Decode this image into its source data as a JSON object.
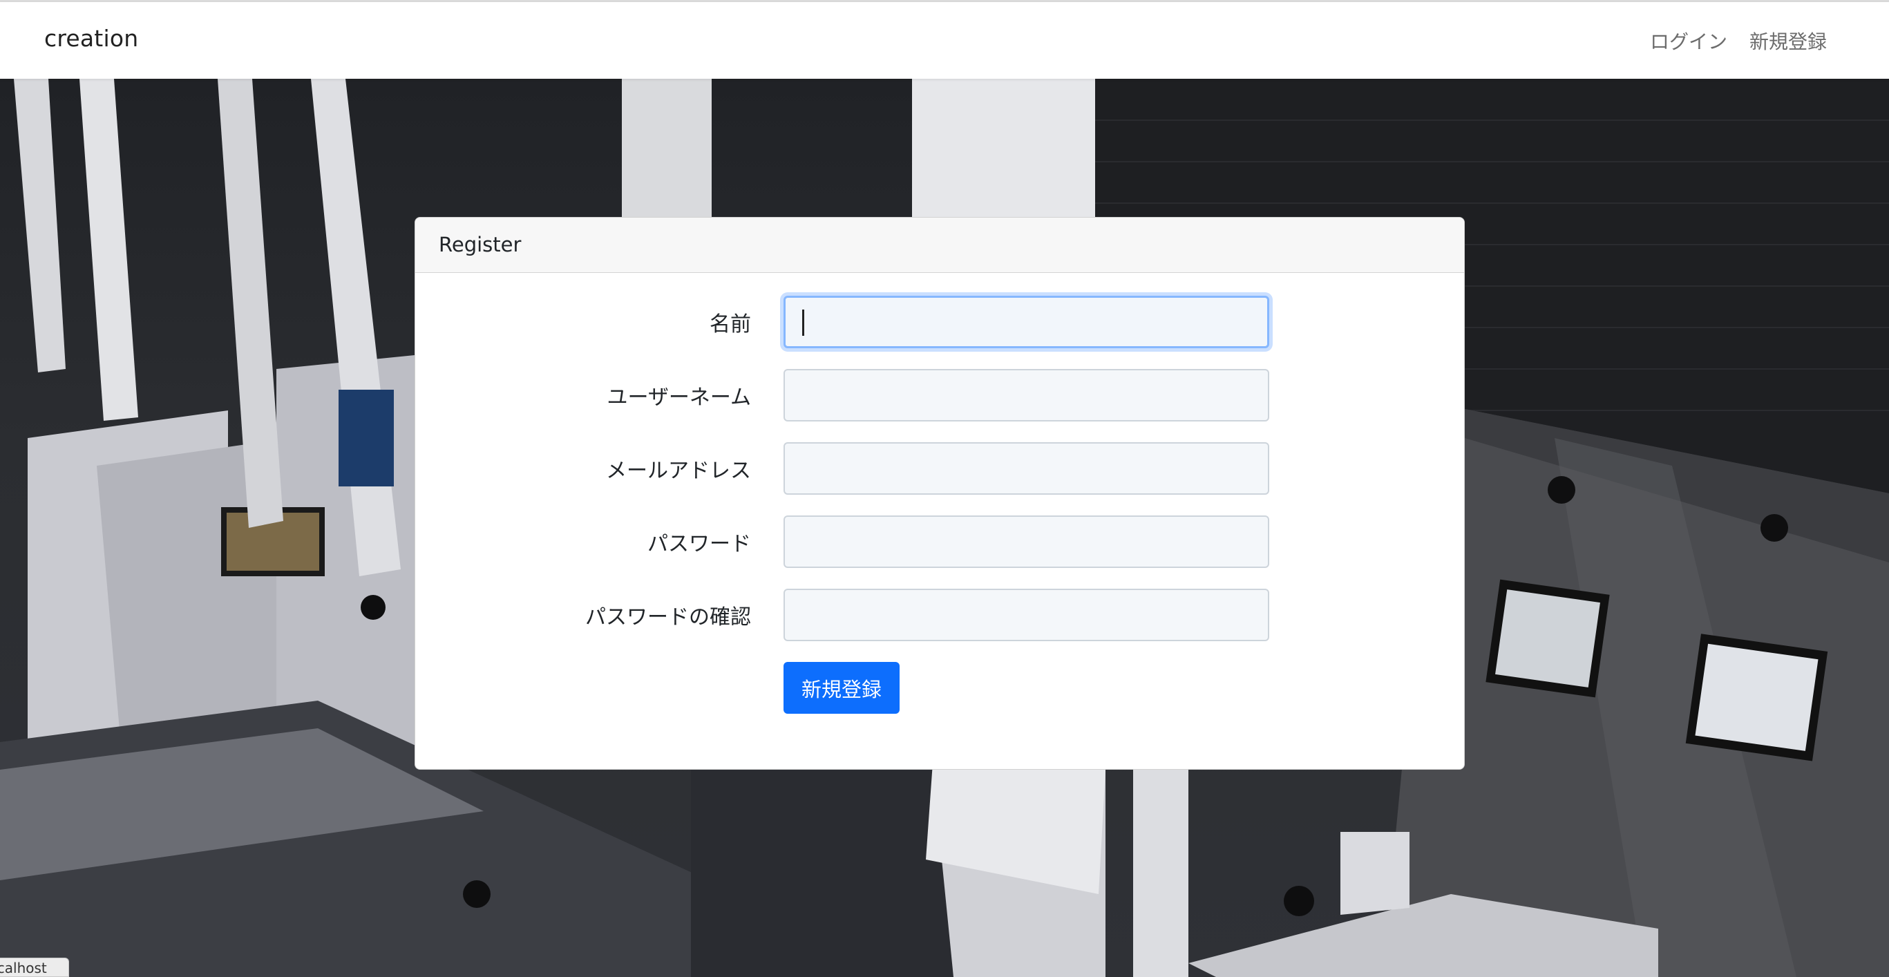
{
  "navbar": {
    "brand": "creation",
    "links": [
      "ログイン",
      "新規登録"
    ]
  },
  "form": {
    "header": "Register",
    "fields": [
      {
        "label": "名前",
        "value": ""
      },
      {
        "label": "ユーザーネーム",
        "value": ""
      },
      {
        "label": "メールアドレス",
        "value": ""
      },
      {
        "label": "パスワード",
        "value": ""
      },
      {
        "label": "パスワードの確認",
        "value": ""
      }
    ],
    "submit_label": "新規登録"
  },
  "status_bar": {
    "url": "localhost"
  },
  "colors": {
    "primary": "#0d6efd",
    "focus_ring": "#86b7fe",
    "input_bg": "#f4f7fa"
  }
}
